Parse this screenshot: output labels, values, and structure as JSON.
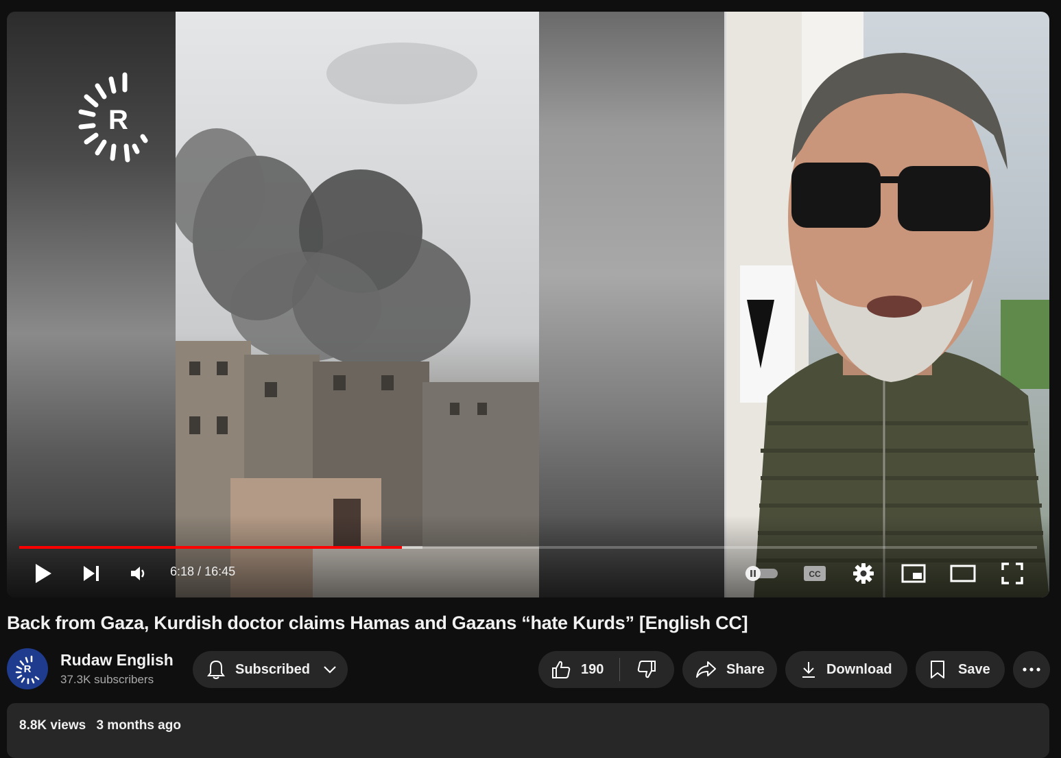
{
  "player": {
    "current_time": "6:18",
    "duration": "16:45",
    "time_separator": " / ",
    "progress_played": 0.376,
    "progress_buffered": 0.396,
    "logo_letter": "R",
    "accent_color": "#ff0000"
  },
  "video": {
    "title": "Back from Gaza, Kurdish doctor claims Hamas and Gazans “hate Kurds” [English CC]"
  },
  "channel": {
    "name": "Rudaw English",
    "subscribers": "37.3K subscribers",
    "avatar_letter": "R",
    "avatar_color": "#1f3b8e"
  },
  "actions": {
    "subscribed_label": "Subscribed",
    "like_count": "190",
    "share_label": "Share",
    "download_label": "Download",
    "save_label": "Save"
  },
  "description": {
    "views": "8.8K views",
    "posted": "3 months ago"
  },
  "icons": {
    "play": "play-icon",
    "next": "next-icon",
    "volume": "volume-icon",
    "autoplay": "autoplay-toggle-icon",
    "captions": "captions-icon",
    "settings": "gear-icon",
    "miniplayer": "miniplayer-icon",
    "theater": "theater-mode-icon",
    "fullscreen": "fullscreen-icon",
    "bell": "bell-icon",
    "like": "thumbs-up-icon",
    "dislike": "thumbs-down-icon",
    "share": "share-arrow-icon",
    "download": "download-icon",
    "save": "bookmark-icon",
    "more": "more-horizontal-icon"
  }
}
